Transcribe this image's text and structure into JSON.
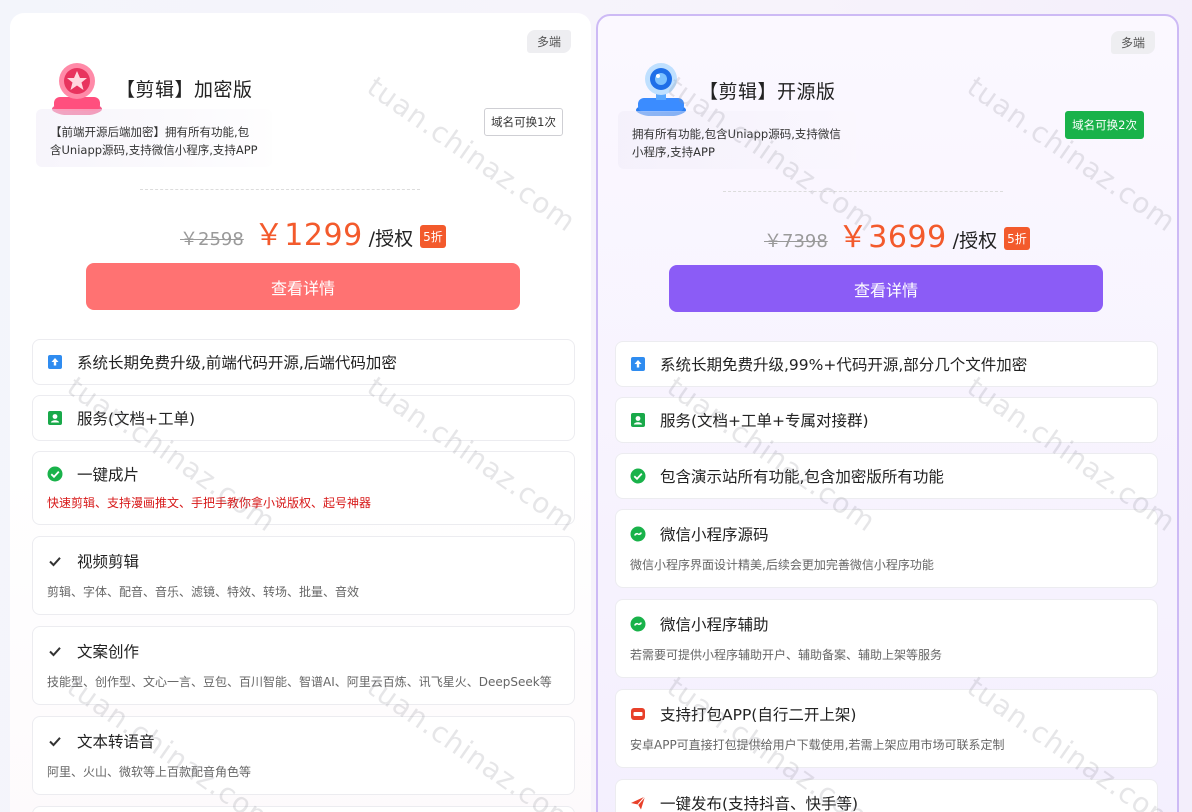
{
  "plans": [
    {
      "badge": "多端",
      "title": "【剪辑】加密版",
      "desc": "【前端开源后端加密】拥有所有功能,包含Uniapp源码,支持微信小程序,支持APP",
      "domain_tag": "域名可换1次",
      "old_price": "￥2598",
      "new_price": "￥1299",
      "per": "/授权",
      "discount": "5折",
      "button": "查看详情",
      "features": [
        {
          "icon": "upgrade-icon",
          "title": "系统长期免费升级,前端代码开源,后端代码加密",
          "sub": ""
        },
        {
          "icon": "service-icon",
          "title": "服务(文档+工单)",
          "sub": ""
        },
        {
          "icon": "check-circle-icon",
          "title": "一键成片",
          "sub": "快速剪辑、支持漫画推文、手把手教你拿小说版权、起号神器"
        },
        {
          "icon": "check-icon",
          "title": "视频剪辑",
          "sub": "剪辑、字体、配音、音乐、滤镜、特效、转场、批量、音效"
        },
        {
          "icon": "check-icon",
          "title": "文案创作",
          "sub": "技能型、创作型、文心一言、豆包、百川智能、智谱AI、阿里云百炼、讯飞星火、DeepSeek等"
        },
        {
          "icon": "check-icon",
          "title": "文本转语音",
          "sub": "阿里、火山、微软等上百款配音角色等"
        }
      ]
    },
    {
      "badge": "多端",
      "title": "【剪辑】开源版",
      "desc": "拥有所有功能,包含Uniapp源码,支持微信小程序,支持APP",
      "domain_tag": "域名可换2次",
      "old_price": "￥7398",
      "new_price": "￥3699",
      "per": "/授权",
      "discount": "5折",
      "button": "查看详情",
      "features": [
        {
          "icon": "upgrade-icon",
          "title": "系统长期免费升级,99%+代码开源,部分几个文件加密",
          "sub": ""
        },
        {
          "icon": "service-icon",
          "title": "服务(文档+工单+专属对接群)",
          "sub": ""
        },
        {
          "icon": "check-circle-icon",
          "title": "包含演示站所有功能,包含加密版所有功能",
          "sub": ""
        },
        {
          "icon": "miniprogram-icon",
          "title": "微信小程序源码",
          "sub": "微信小程序界面设计精美,后续会更加完善微信小程序功能"
        },
        {
          "icon": "miniprogram-icon",
          "title": "微信小程序辅助",
          "sub": "若需要可提供小程序辅助开户、辅助备案、辅助上架等服务"
        },
        {
          "icon": "app-icon",
          "title": "支持打包APP(自行二开上架)",
          "sub": "安卓APP可直接打包提供给用户下载使用,若需上架应用市场可联系定制"
        },
        {
          "icon": "send-icon",
          "title": "一键发布(支持抖音、快手等)",
          "sub": ""
        }
      ]
    }
  ],
  "watermark": "tuan.chinaz.com"
}
